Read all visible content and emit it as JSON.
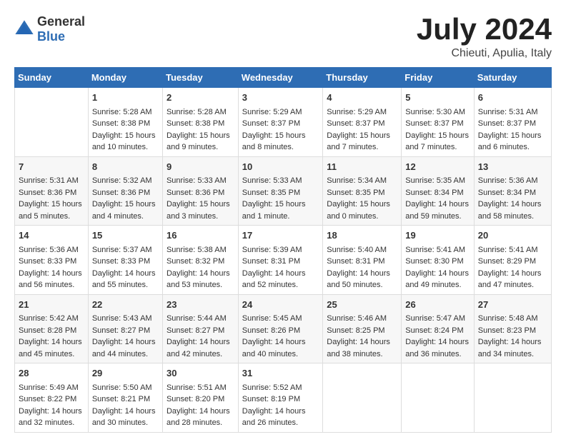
{
  "logo": {
    "general": "General",
    "blue": "Blue"
  },
  "title": "July 2024",
  "location": "Chieuti, Apulia, Italy",
  "days_of_week": [
    "Sunday",
    "Monday",
    "Tuesday",
    "Wednesday",
    "Thursday",
    "Friday",
    "Saturday"
  ],
  "weeks": [
    [
      {
        "day": "",
        "sunrise": "",
        "sunset": "",
        "daylight": ""
      },
      {
        "day": "1",
        "sunrise": "Sunrise: 5:28 AM",
        "sunset": "Sunset: 8:38 PM",
        "daylight": "Daylight: 15 hours and 10 minutes."
      },
      {
        "day": "2",
        "sunrise": "Sunrise: 5:28 AM",
        "sunset": "Sunset: 8:38 PM",
        "daylight": "Daylight: 15 hours and 9 minutes."
      },
      {
        "day": "3",
        "sunrise": "Sunrise: 5:29 AM",
        "sunset": "Sunset: 8:37 PM",
        "daylight": "Daylight: 15 hours and 8 minutes."
      },
      {
        "day": "4",
        "sunrise": "Sunrise: 5:29 AM",
        "sunset": "Sunset: 8:37 PM",
        "daylight": "Daylight: 15 hours and 7 minutes."
      },
      {
        "day": "5",
        "sunrise": "Sunrise: 5:30 AM",
        "sunset": "Sunset: 8:37 PM",
        "daylight": "Daylight: 15 hours and 7 minutes."
      },
      {
        "day": "6",
        "sunrise": "Sunrise: 5:31 AM",
        "sunset": "Sunset: 8:37 PM",
        "daylight": "Daylight: 15 hours and 6 minutes."
      }
    ],
    [
      {
        "day": "7",
        "sunrise": "Sunrise: 5:31 AM",
        "sunset": "Sunset: 8:36 PM",
        "daylight": "Daylight: 15 hours and 5 minutes."
      },
      {
        "day": "8",
        "sunrise": "Sunrise: 5:32 AM",
        "sunset": "Sunset: 8:36 PM",
        "daylight": "Daylight: 15 hours and 4 minutes."
      },
      {
        "day": "9",
        "sunrise": "Sunrise: 5:33 AM",
        "sunset": "Sunset: 8:36 PM",
        "daylight": "Daylight: 15 hours and 3 minutes."
      },
      {
        "day": "10",
        "sunrise": "Sunrise: 5:33 AM",
        "sunset": "Sunset: 8:35 PM",
        "daylight": "Daylight: 15 hours and 1 minute."
      },
      {
        "day": "11",
        "sunrise": "Sunrise: 5:34 AM",
        "sunset": "Sunset: 8:35 PM",
        "daylight": "Daylight: 15 hours and 0 minutes."
      },
      {
        "day": "12",
        "sunrise": "Sunrise: 5:35 AM",
        "sunset": "Sunset: 8:34 PM",
        "daylight": "Daylight: 14 hours and 59 minutes."
      },
      {
        "day": "13",
        "sunrise": "Sunrise: 5:36 AM",
        "sunset": "Sunset: 8:34 PM",
        "daylight": "Daylight: 14 hours and 58 minutes."
      }
    ],
    [
      {
        "day": "14",
        "sunrise": "Sunrise: 5:36 AM",
        "sunset": "Sunset: 8:33 PM",
        "daylight": "Daylight: 14 hours and 56 minutes."
      },
      {
        "day": "15",
        "sunrise": "Sunrise: 5:37 AM",
        "sunset": "Sunset: 8:33 PM",
        "daylight": "Daylight: 14 hours and 55 minutes."
      },
      {
        "day": "16",
        "sunrise": "Sunrise: 5:38 AM",
        "sunset": "Sunset: 8:32 PM",
        "daylight": "Daylight: 14 hours and 53 minutes."
      },
      {
        "day": "17",
        "sunrise": "Sunrise: 5:39 AM",
        "sunset": "Sunset: 8:31 PM",
        "daylight": "Daylight: 14 hours and 52 minutes."
      },
      {
        "day": "18",
        "sunrise": "Sunrise: 5:40 AM",
        "sunset": "Sunset: 8:31 PM",
        "daylight": "Daylight: 14 hours and 50 minutes."
      },
      {
        "day": "19",
        "sunrise": "Sunrise: 5:41 AM",
        "sunset": "Sunset: 8:30 PM",
        "daylight": "Daylight: 14 hours and 49 minutes."
      },
      {
        "day": "20",
        "sunrise": "Sunrise: 5:41 AM",
        "sunset": "Sunset: 8:29 PM",
        "daylight": "Daylight: 14 hours and 47 minutes."
      }
    ],
    [
      {
        "day": "21",
        "sunrise": "Sunrise: 5:42 AM",
        "sunset": "Sunset: 8:28 PM",
        "daylight": "Daylight: 14 hours and 45 minutes."
      },
      {
        "day": "22",
        "sunrise": "Sunrise: 5:43 AM",
        "sunset": "Sunset: 8:27 PM",
        "daylight": "Daylight: 14 hours and 44 minutes."
      },
      {
        "day": "23",
        "sunrise": "Sunrise: 5:44 AM",
        "sunset": "Sunset: 8:27 PM",
        "daylight": "Daylight: 14 hours and 42 minutes."
      },
      {
        "day": "24",
        "sunrise": "Sunrise: 5:45 AM",
        "sunset": "Sunset: 8:26 PM",
        "daylight": "Daylight: 14 hours and 40 minutes."
      },
      {
        "day": "25",
        "sunrise": "Sunrise: 5:46 AM",
        "sunset": "Sunset: 8:25 PM",
        "daylight": "Daylight: 14 hours and 38 minutes."
      },
      {
        "day": "26",
        "sunrise": "Sunrise: 5:47 AM",
        "sunset": "Sunset: 8:24 PM",
        "daylight": "Daylight: 14 hours and 36 minutes."
      },
      {
        "day": "27",
        "sunrise": "Sunrise: 5:48 AM",
        "sunset": "Sunset: 8:23 PM",
        "daylight": "Daylight: 14 hours and 34 minutes."
      }
    ],
    [
      {
        "day": "28",
        "sunrise": "Sunrise: 5:49 AM",
        "sunset": "Sunset: 8:22 PM",
        "daylight": "Daylight: 14 hours and 32 minutes."
      },
      {
        "day": "29",
        "sunrise": "Sunrise: 5:50 AM",
        "sunset": "Sunset: 8:21 PM",
        "daylight": "Daylight: 14 hours and 30 minutes."
      },
      {
        "day": "30",
        "sunrise": "Sunrise: 5:51 AM",
        "sunset": "Sunset: 8:20 PM",
        "daylight": "Daylight: 14 hours and 28 minutes."
      },
      {
        "day": "31",
        "sunrise": "Sunrise: 5:52 AM",
        "sunset": "Sunset: 8:19 PM",
        "daylight": "Daylight: 14 hours and 26 minutes."
      },
      {
        "day": "",
        "sunrise": "",
        "sunset": "",
        "daylight": ""
      },
      {
        "day": "",
        "sunrise": "",
        "sunset": "",
        "daylight": ""
      },
      {
        "day": "",
        "sunrise": "",
        "sunset": "",
        "daylight": ""
      }
    ]
  ]
}
